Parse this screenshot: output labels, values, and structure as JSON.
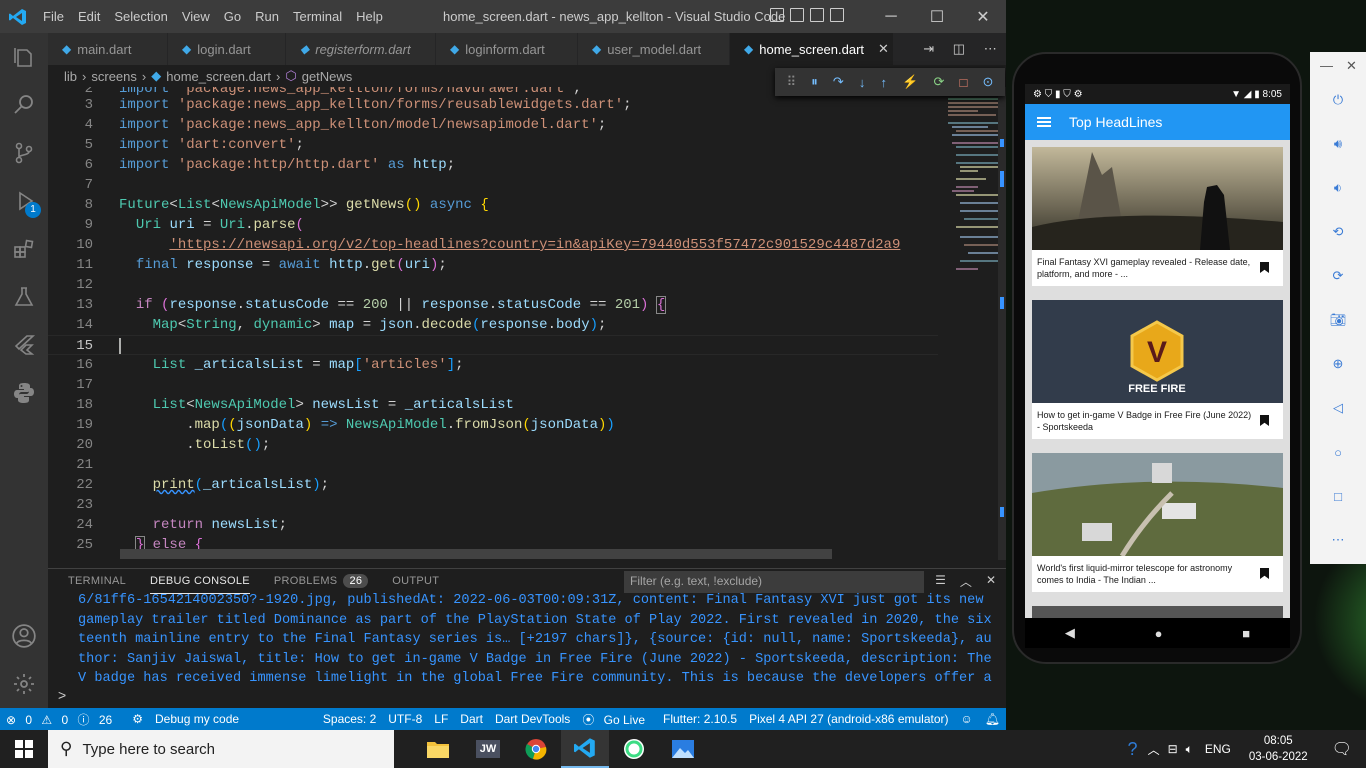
{
  "window": {
    "title": "home_screen.dart - news_app_kellton - Visual Studio Code"
  },
  "menu": [
    "File",
    "Edit",
    "Selection",
    "View",
    "Go",
    "Run",
    "Terminal",
    "Help"
  ],
  "tabs": [
    {
      "label": "main.dart"
    },
    {
      "label": "login.dart"
    },
    {
      "label": "registerform.dart"
    },
    {
      "label": "loginform.dart"
    },
    {
      "label": "user_model.dart"
    },
    {
      "label": "home_screen.dart"
    }
  ],
  "breadcrumb": [
    "lib",
    "screens",
    "home_screen.dart",
    "getNews"
  ],
  "editor": {
    "first_line": "  'package:news_app_kellton/forms/navdrawer.dart';",
    "current_line": 15
  },
  "panel": {
    "tabs": [
      "TERMINAL",
      "DEBUG CONSOLE",
      "PROBLEMS",
      "OUTPUT"
    ],
    "problems_count": "26",
    "filter_placeholder": "Filter (e.g. text, !exclude)",
    "output": "6/81ff6-1654214002350?-1920.jpg, publishedAt: 2022-06-03T00:09:31Z, content: Final Fantasy XVI just got its new gameplay trailer titled Dominance as part of the PlayStation State of Play 2022. First revealed in 2020, the sixteenth mainline entry to the Final Fantasy series is… [+2197 chars]}, {source: {id: null, name: Sportskeeda}, author: Sanjiv Jaiswal, title: How to get in-game V Badge in Free Fire (June 2022) - Sportskeeda, description: The V badge has received immense limelight in the global Free Fire community. This is because the developers offer a",
    "prompt": ">"
  },
  "statusbar": {
    "errors": "0",
    "warnings": "0",
    "info": "26",
    "debug": "Debug my code",
    "spaces": "Spaces: 2",
    "encoding": "UTF-8",
    "eol": "LF",
    "lang": "Dart",
    "devtools": "Dart DevTools",
    "golive": "Go Live",
    "flutter": "Flutter: 2.10.5",
    "device": "Pixel 4 API 27 (android-x86 emulator)"
  },
  "activity_badge": "1",
  "phone": {
    "time": "8:05",
    "appbar_title": "Top HeadLines",
    "cards": [
      {
        "title": "Final Fantasy XVI gameplay revealed - Release date, platform, and more - ..."
      },
      {
        "title": "How to get in-game V Badge in Free Fire (June 2022) - Sportskeeda"
      },
      {
        "title": "World's first liquid-mirror telescope for astronomy comes to India - The Indian ..."
      }
    ],
    "freefire_text": "FREE FIRE",
    "v_text": "V"
  },
  "taskbar": {
    "search_placeholder": "Type here to search",
    "lang": "ENG",
    "time": "08:05",
    "date": "03-06-2022",
    "jw": "JW"
  }
}
